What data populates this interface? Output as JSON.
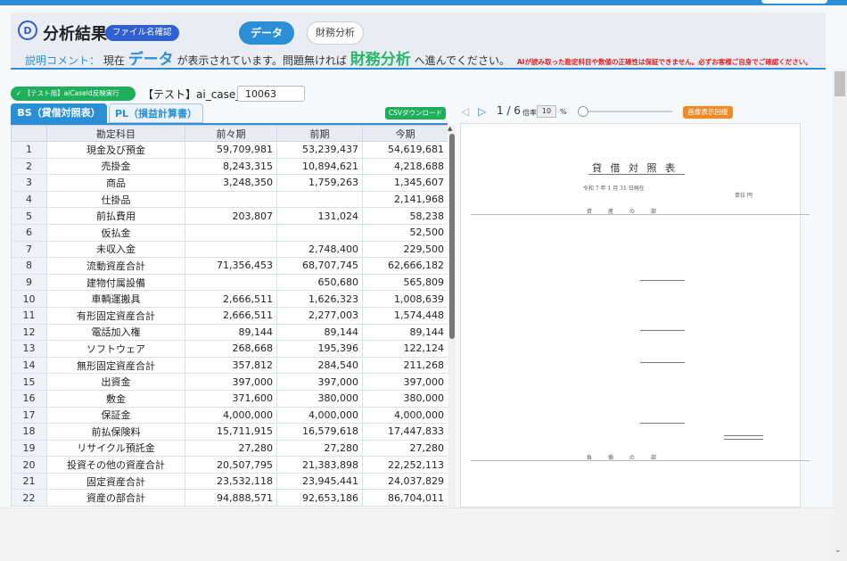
{
  "header": {
    "title": "分析結果",
    "filename_button": "ファイル名確認",
    "tab_data": "データ",
    "tab_fin": "財務分析",
    "comment_label": "説明コメント：",
    "comment_pre": "現在",
    "comment_data": "データ",
    "comment_mid": "が表示されています。問題無ければ",
    "comment_fin": "財務分析",
    "comment_post": "へ進んでください。",
    "warning": "AIが読み取った勘定科目や数値の正確性は保証できません。必ずお客様ご自身でご確認ください。"
  },
  "controls": {
    "run_button": "【テスト用】aiCaseId反映実行",
    "test_label": "【テスト】ai_case_id",
    "case_id": "10063"
  },
  "tabs": {
    "bs": "BS（貸借対照表）",
    "pl": "PL（損益計算書）",
    "csv": "CSVダウンロード"
  },
  "table": {
    "headers": [
      "",
      "勘定科目",
      "前々期",
      "前期",
      "今期"
    ],
    "rows": [
      [
        "1",
        "現金及び預金",
        "59,709,981",
        "53,239,437",
        "54,619,681"
      ],
      [
        "2",
        "売掛金",
        "8,243,315",
        "10,894,621",
        "4,218,688"
      ],
      [
        "3",
        "商品",
        "3,248,350",
        "1,759,263",
        "1,345,607"
      ],
      [
        "4",
        "仕掛品",
        "",
        "",
        "2,141,968"
      ],
      [
        "5",
        "前払費用",
        "203,807",
        "131,024",
        "58,238"
      ],
      [
        "6",
        "仮払金",
        "",
        "",
        "52,500"
      ],
      [
        "7",
        "未収入金",
        "",
        "2,748,400",
        "229,500"
      ],
      [
        "8",
        "流動資産合計",
        "71,356,453",
        "68,707,745",
        "62,666,182"
      ],
      [
        "9",
        "建物付属設備",
        "",
        "650,680",
        "565,809"
      ],
      [
        "10",
        "車輌運搬具",
        "2,666,511",
        "1,626,323",
        "1,008,639"
      ],
      [
        "11",
        "有形固定資産合計",
        "2,666,511",
        "2,277,003",
        "1,574,448"
      ],
      [
        "12",
        "電話加入権",
        "89,144",
        "89,144",
        "89,144"
      ],
      [
        "13",
        "ソフトウェア",
        "268,668",
        "195,396",
        "122,124"
      ],
      [
        "14",
        "無形固定資産合計",
        "357,812",
        "284,540",
        "211,268"
      ],
      [
        "15",
        "出資金",
        "397,000",
        "397,000",
        "397,000"
      ],
      [
        "16",
        "敷金",
        "371,600",
        "380,000",
        "380,000"
      ],
      [
        "17",
        "保証金",
        "4,000,000",
        "4,000,000",
        "4,000,000"
      ],
      [
        "18",
        "前払保険料",
        "15,711,915",
        "16,579,618",
        "17,447,833"
      ],
      [
        "19",
        "リサイクル預託金",
        "27,280",
        "27,280",
        "27,280"
      ],
      [
        "20",
        "投資その他の資産合計",
        "20,507,795",
        "21,383,898",
        "22,252,113"
      ],
      [
        "21",
        "固定資産合計",
        "23,532,118",
        "23,945,441",
        "24,037,829"
      ],
      [
        "22",
        "資産の部合計",
        "94,888,571",
        "92,653,186",
        "86,704,011"
      ]
    ]
  },
  "viewer": {
    "page": "1 / 6",
    "zoom_label": "倍率",
    "zoom_value": "10",
    "zoom_unit": "%",
    "zoom_level": 0.06,
    "reset_button": "画像表示回復",
    "doc_title": "貸 借 対 照 表",
    "doc_date": "令和 7 年 1 月 31 日現在",
    "doc_unit": "単位 円",
    "doc_section": "資　　産　　の　　部",
    "doc_liab": "負　　債　　の　　部"
  },
  "colors": {
    "accent": "#2a8fd6",
    "green": "#1fae5a",
    "orange": "#f08a24",
    "warn": "#e02020"
  }
}
